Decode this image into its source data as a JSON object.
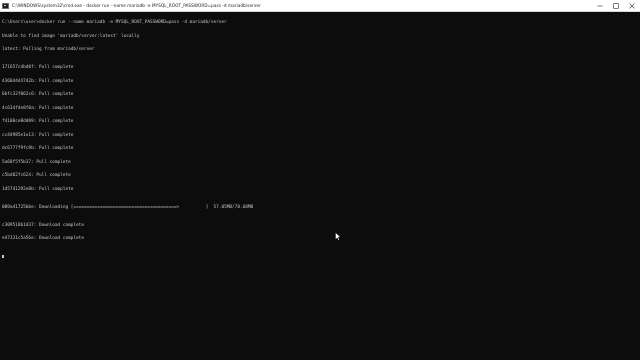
{
  "window": {
    "title": "C:\\WINDOWS\\system32\\cmd.exe - docker run --name mariadb -e MYSQL_ROOT_PASSWORD=pass -d mariadb/server",
    "minimize_icon": "minimize-icon",
    "maximize_icon": "maximize-icon",
    "close_icon": "close-icon"
  },
  "console": {
    "prompt_line": "C:\\Users\\user>docker run --name mariadb -e MYSQL_ROOT_PASSWORD=pass -d mariadb/server",
    "unable_line": "Unable to find image 'mariadb/server:latest' locally",
    "pulling_line": "latest: Pulling from mariadb/server",
    "layers": [
      {
        "id": "171657c4bd0f",
        "status": "Pull complete"
      },
      {
        "id": "43604444742b",
        "status": "Pull complete"
      },
      {
        "id": "6bfc32f062c6",
        "status": "Pull complete"
      },
      {
        "id": "4c634f4e8f0a",
        "status": "Pull complete"
      },
      {
        "id": "f4100ce8dd09",
        "status": "Pull complete"
      },
      {
        "id": "cc44985e1e13",
        "status": "Pull complete"
      },
      {
        "id": "dc6777f9fc9b",
        "status": "Pull complete"
      },
      {
        "id": "5a68f5f5b37",
        "status": "Pull complete"
      },
      {
        "id": "c5bd82fc624",
        "status": "Pull complete"
      },
      {
        "id": "1d5741292e8b",
        "status": "Pull complete"
      }
    ],
    "downloading": {
      "id": "089a41725bbe",
      "status": "Downloading",
      "bar": "[=======================================>          ]",
      "size": "57.05MB/78.68MB",
      "progress": 0.7251
    },
    "downloads": [
      {
        "id": "c309518b1d37",
        "status": "Download complete"
      },
      {
        "id": "e47331c5a56e",
        "status": "Download complete"
      }
    ]
  },
  "colors": {
    "background": "#0c0c0c",
    "text": "#c9c9c9",
    "titlebar": "#ffffff"
  }
}
